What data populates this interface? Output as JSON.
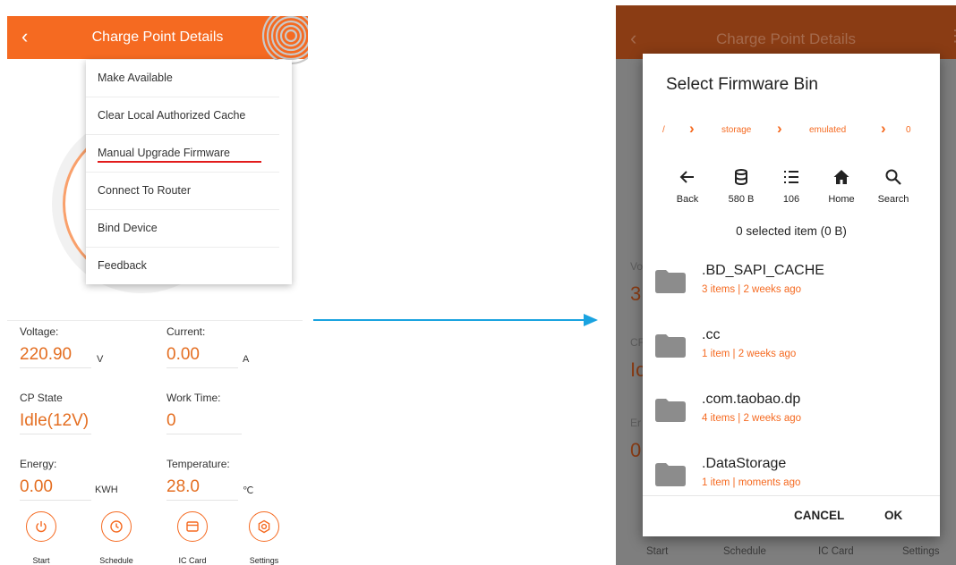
{
  "left_screen": {
    "title": "Charge Point Details",
    "back_icon": "chevron-left-icon",
    "menu": [
      "Make Available",
      "Clear Local Authorized Cache",
      "Manual Upgrade Firmware",
      "Connect To Router",
      "Bind Device",
      "Feedback"
    ],
    "metrics": {
      "voltage": {
        "label": "Voltage:",
        "value": "220.90",
        "unit": "V"
      },
      "current": {
        "label": "Current:",
        "value": "0.00",
        "unit": "A"
      },
      "cp_state": {
        "label": "CP State",
        "value": "Idle(12V)"
      },
      "work_time": {
        "label": "Work Time:",
        "value": "0"
      },
      "energy": {
        "label": "Energy:",
        "value": "0.00",
        "unit": "KWH"
      },
      "temperature": {
        "label": "Temperature:",
        "value": "28.0",
        "unit": "℃"
      }
    },
    "bottom_nav": [
      "Start",
      "Schedule",
      "IC Card",
      "Settings"
    ]
  },
  "right_screen": {
    "title": "Charge Point Details",
    "background_values": {
      "vo": "Vo",
      "three": "3",
      "cp": "CF",
      "ic": "Ic",
      "er": "Er",
      "zero": "0"
    },
    "dialog": {
      "title": "Select Firmware Bin",
      "breadcrumb": [
        "/",
        "storage",
        "emulated",
        "0"
      ],
      "toolbar": [
        {
          "icon": "arrow-left-icon",
          "label": "Back"
        },
        {
          "icon": "database-icon",
          "label": "580 B"
        },
        {
          "icon": "list-icon",
          "label": "106"
        },
        {
          "icon": "home-icon",
          "label": "Home"
        },
        {
          "icon": "search-icon",
          "label": "Search"
        }
      ],
      "selection": "0 selected item (0 B)",
      "folders": [
        {
          "name": ".BD_SAPI_CACHE",
          "meta": "3 items  |  2 weeks ago"
        },
        {
          "name": ".cc",
          "meta": "1 item  |  2 weeks ago"
        },
        {
          "name": ".com.taobao.dp",
          "meta": "4 items  |  2 weeks ago"
        },
        {
          "name": ".DataStorage",
          "meta": "1 item  |  moments ago"
        }
      ],
      "cancel": "CANCEL",
      "ok": "OK"
    },
    "bottom_nav": [
      "Start",
      "Schedule",
      "IC Card",
      "Settings"
    ]
  },
  "colors": {
    "accent": "#f56a21",
    "value": "#e46e21",
    "underline": "#e21b1b",
    "arrow": "#1aa3e0"
  }
}
